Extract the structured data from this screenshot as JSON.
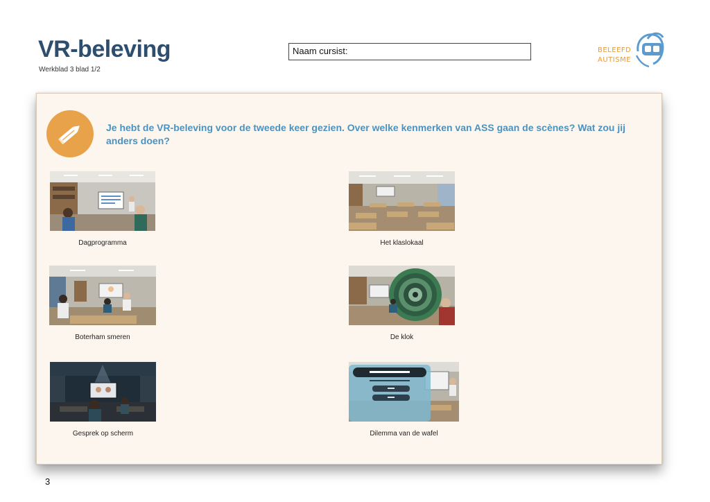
{
  "header": {
    "title": "VR-beleving",
    "subtitle": "Werkblad 3 blad 1/2",
    "name_field_label": "Naam cursist:"
  },
  "logo": {
    "line1": "BELEEFD",
    "line2": "AUTISME",
    "icon": "vr-headset-head-icon"
  },
  "colors": {
    "title": "#2d4e6e",
    "accent_orange": "#e8a24a",
    "question_blue": "#4a92bf",
    "panel_bg": "#fdf6ee"
  },
  "assignment": {
    "icon": "pencil-icon",
    "question": "Je hebt de VR-beleving voor de tweede keer gezien. Over welke kenmerken van ASS gaan de scènes? Wat zou jij anders doen?"
  },
  "scenes": [
    {
      "caption": "Dagprogramma"
    },
    {
      "caption": "Het klaslokaal"
    },
    {
      "caption": "Boterham smeren"
    },
    {
      "caption": "De klok"
    },
    {
      "caption": "Gesprek op scherm"
    },
    {
      "caption": "Dilemma van de wafel"
    }
  ],
  "page_number": "3"
}
